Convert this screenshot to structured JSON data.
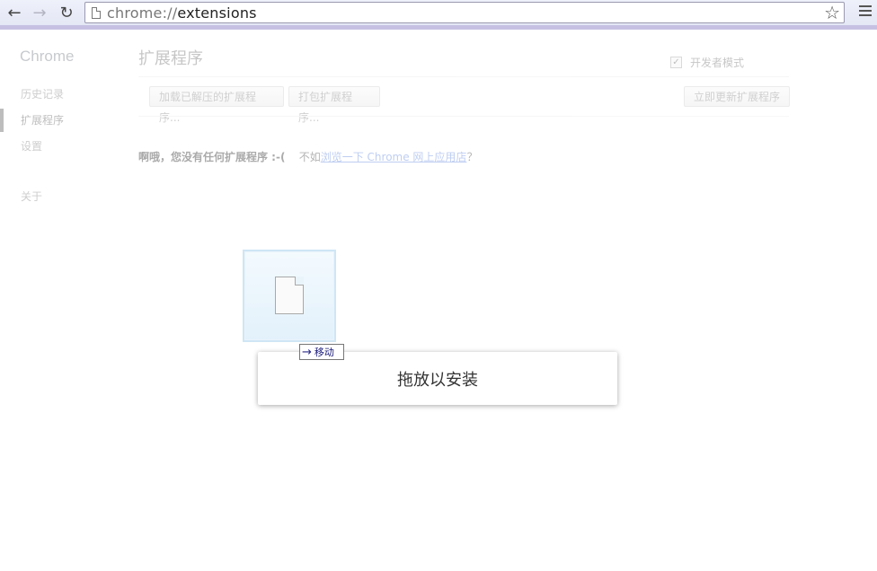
{
  "toolbar": {
    "url_scheme": "chrome://",
    "url_path": "extensions",
    "back_icon": "back-arrow-icon",
    "forward_icon": "forward-arrow-icon",
    "reload_icon": "reload-icon",
    "star_icon": "star-icon",
    "menu_icon": "menu-icon"
  },
  "sidebar": {
    "title": "Chrome",
    "items": [
      {
        "label": "历史记录"
      },
      {
        "label": "扩展程序",
        "selected": true
      },
      {
        "label": "设置"
      },
      {
        "label": "关于"
      }
    ]
  },
  "main": {
    "title": "扩展程序",
    "developer_mode_label": "开发者模式",
    "developer_mode_checked": true,
    "load_unpacked_label": "加载已解压的扩展程序...",
    "pack_label": "打包扩展程序...",
    "update_label": "立即更新扩展程序",
    "empty_message": "啊哦，您没有任何扩展程序 :-(",
    "browse_prefix": "不如",
    "browse_link": "浏览一下 Chrome 网上应用店",
    "browse_suffix": "？"
  },
  "drag": {
    "move_tooltip": "移动",
    "drop_text": "拖放以安装"
  }
}
